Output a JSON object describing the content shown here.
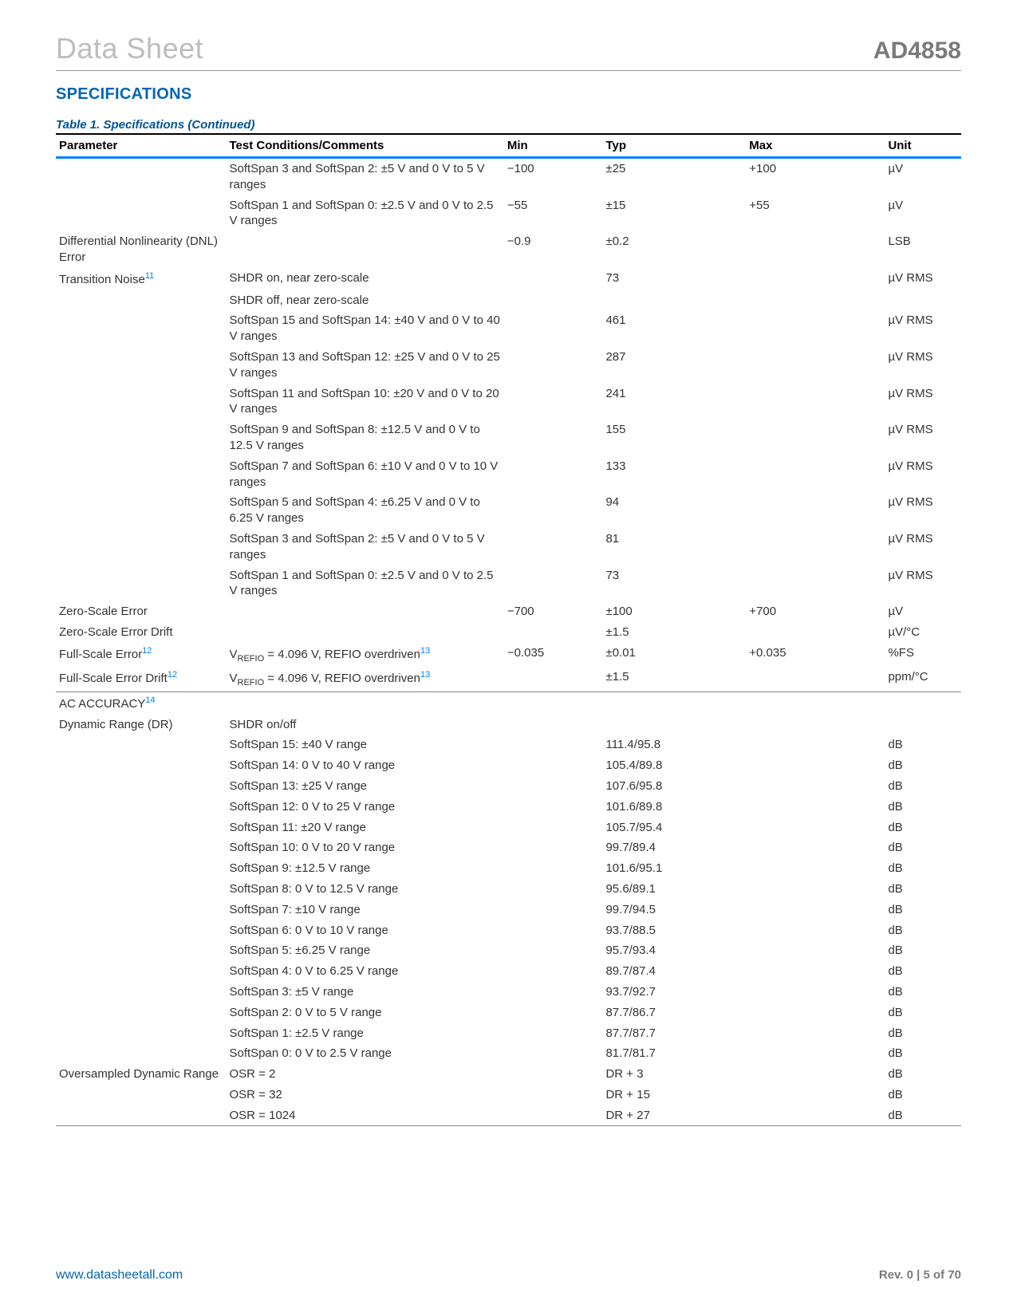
{
  "header": {
    "doc_type": "Data Sheet",
    "part_number": "AD4858"
  },
  "section_title": "SPECIFICATIONS",
  "table_caption": "Table 1. Specifications (Continued)",
  "columns": {
    "parameter": "Parameter",
    "conditions": "Test Conditions/Comments",
    "min": "Min",
    "typ": "Typ",
    "max": "Max",
    "unit": "Unit"
  },
  "rows": [
    {
      "param": "",
      "cond": "SoftSpan 3 and SoftSpan 2: ±5 V and 0 V to 5 V ranges",
      "min": "−100",
      "typ": "±25",
      "max": "+100",
      "unit": "µV"
    },
    {
      "param": "",
      "cond": "SoftSpan 1 and SoftSpan 0: ±2.5 V and 0 V to 2.5 V ranges",
      "min": "−55",
      "typ": "±15",
      "max": "+55",
      "unit": "µV"
    },
    {
      "param": "Differential Nonlinearity (DNL) Error",
      "cond": "",
      "min": "−0.9",
      "typ": "±0.2",
      "max": "",
      "unit": "LSB"
    },
    {
      "param_html": "Transition Noise<span class=\"sup\">11</span>",
      "cond": "SHDR on, near zero-scale",
      "min": "",
      "typ": "73",
      "max": "",
      "unit": "µV RMS"
    },
    {
      "param": "",
      "cond": "SHDR off, near zero-scale",
      "min": "",
      "typ": "",
      "max": "",
      "unit": ""
    },
    {
      "param": "",
      "cond": "SoftSpan 15 and SoftSpan 14: ±40 V and 0 V to 40 V ranges",
      "min": "",
      "typ": "461",
      "max": "",
      "unit": "µV RMS"
    },
    {
      "param": "",
      "cond": "SoftSpan 13 and SoftSpan 12: ±25 V and 0 V to 25 V ranges",
      "min": "",
      "typ": "287",
      "max": "",
      "unit": "µV RMS"
    },
    {
      "param": "",
      "cond": "SoftSpan 11 and SoftSpan 10: ±20 V and 0 V to 20 V ranges",
      "min": "",
      "typ": "241",
      "max": "",
      "unit": "µV RMS"
    },
    {
      "param": "",
      "cond": "SoftSpan 9 and SoftSpan 8: ±12.5 V and 0 V to 12.5 V ranges",
      "min": "",
      "typ": "155",
      "max": "",
      "unit": "µV RMS"
    },
    {
      "param": "",
      "cond": "SoftSpan 7 and SoftSpan 6: ±10 V and 0 V to 10 V ranges",
      "min": "",
      "typ": "133",
      "max": "",
      "unit": "µV RMS"
    },
    {
      "param": "",
      "cond": "SoftSpan 5 and SoftSpan 4: ±6.25 V and 0 V to 6.25 V ranges",
      "min": "",
      "typ": "94",
      "max": "",
      "unit": "µV RMS"
    },
    {
      "param": "",
      "cond": "SoftSpan 3 and SoftSpan 2: ±5 V and 0 V to 5 V ranges",
      "min": "",
      "typ": "81",
      "max": "",
      "unit": "µV RMS"
    },
    {
      "param": "",
      "cond": "SoftSpan 1 and SoftSpan 0: ±2.5 V and 0 V to 2.5 V ranges",
      "min": "",
      "typ": "73",
      "max": "",
      "unit": "µV RMS"
    },
    {
      "param": "Zero-Scale Error",
      "cond": "",
      "min": "−700",
      "typ": "±100",
      "max": "+700",
      "unit": "µV"
    },
    {
      "param": "Zero-Scale Error Drift",
      "cond": "",
      "min": "",
      "typ": "±1.5",
      "max": "",
      "unit": "µV/°C"
    },
    {
      "param_html": "Full-Scale Error<span class=\"sup\">12</span>",
      "cond_html": "V<span class=\"subscript\">REFIO</span> = 4.096 V, REFIO overdriven<span class=\"sup\">13</span>",
      "min": "−0.035",
      "typ": "±0.01",
      "max": "+0.035",
      "unit": "%FS"
    },
    {
      "param_html": "Full-Scale Error Drift<span class=\"sup\">12</span>",
      "cond_html": "V<span class=\"subscript\">REFIO</span> = 4.096 V, REFIO overdriven<span class=\"sup\">13</span>",
      "min": "",
      "typ": "±1.5",
      "max": "",
      "unit": "ppm/°C",
      "section_end": true
    },
    {
      "param_html": "AC ACCURACY<span class=\"sup\">14</span>",
      "level0": true,
      "cond": "",
      "min": "",
      "typ": "",
      "max": "",
      "unit": ""
    },
    {
      "param": "Dynamic Range (DR)",
      "cond": "SHDR on/off",
      "min": "",
      "typ": "",
      "max": "",
      "unit": ""
    },
    {
      "param": "",
      "cond": "SoftSpan 15: ±40 V range",
      "min": "",
      "typ": "111.4/95.8",
      "max": "",
      "unit": "dB"
    },
    {
      "param": "",
      "cond": "SoftSpan 14: 0 V to 40 V range",
      "min": "",
      "typ": "105.4/89.8",
      "max": "",
      "unit": "dB"
    },
    {
      "param": "",
      "cond": "SoftSpan 13: ±25 V range",
      "min": "",
      "typ": "107.6/95.8",
      "max": "",
      "unit": "dB"
    },
    {
      "param": "",
      "cond": "SoftSpan 12: 0 V to 25 V range",
      "min": "",
      "typ": "101.6/89.8",
      "max": "",
      "unit": "dB"
    },
    {
      "param": "",
      "cond": "SoftSpan 11: ±20 V range",
      "min": "",
      "typ": "105.7/95.4",
      "max": "",
      "unit": "dB"
    },
    {
      "param": "",
      "cond": "SoftSpan 10: 0 V to 20 V range",
      "min": "",
      "typ": "99.7/89.4",
      "max": "",
      "unit": "dB"
    },
    {
      "param": "",
      "cond": "SoftSpan 9: ±12.5 V range",
      "min": "",
      "typ": "101.6/95.1",
      "max": "",
      "unit": "dB"
    },
    {
      "param": "",
      "cond": "SoftSpan 8: 0 V to 12.5 V range",
      "min": "",
      "typ": "95.6/89.1",
      "max": "",
      "unit": "dB"
    },
    {
      "param": "",
      "cond": "SoftSpan 7: ±10 V range",
      "min": "",
      "typ": "99.7/94.5",
      "max": "",
      "unit": "dB"
    },
    {
      "param": "",
      "cond": "SoftSpan 6: 0 V to 10 V range",
      "min": "",
      "typ": "93.7/88.5",
      "max": "",
      "unit": "dB"
    },
    {
      "param": "",
      "cond": "SoftSpan 5: ±6.25 V range",
      "min": "",
      "typ": "95.7/93.4",
      "max": "",
      "unit": "dB"
    },
    {
      "param": "",
      "cond": "SoftSpan 4: 0 V to 6.25 V range",
      "min": "",
      "typ": "89.7/87.4",
      "max": "",
      "unit": "dB"
    },
    {
      "param": "",
      "cond": "SoftSpan 3: ±5 V range",
      "min": "",
      "typ": "93.7/92.7",
      "max": "",
      "unit": "dB"
    },
    {
      "param": "",
      "cond": "SoftSpan 2: 0 V to 5 V range",
      "min": "",
      "typ": "87.7/86.7",
      "max": "",
      "unit": "dB"
    },
    {
      "param": "",
      "cond": "SoftSpan 1: ±2.5 V range",
      "min": "",
      "typ": "87.7/87.7",
      "max": "",
      "unit": "dB"
    },
    {
      "param": "",
      "cond": "SoftSpan 0: 0 V to 2.5 V range",
      "min": "",
      "typ": "81.7/81.7",
      "max": "",
      "unit": "dB"
    },
    {
      "param": "Oversampled Dynamic Range",
      "cond": "OSR = 2",
      "min": "",
      "typ": "DR + 3",
      "max": "",
      "unit": "dB"
    },
    {
      "param": "",
      "cond": "OSR = 32",
      "min": "",
      "typ": "DR + 15",
      "max": "",
      "unit": "dB"
    },
    {
      "param": "",
      "cond": "OSR = 1024",
      "min": "",
      "typ": "DR + 27",
      "max": "",
      "unit": "dB",
      "section_end": true
    }
  ],
  "footer": {
    "url": "www.datasheetall.com",
    "rev": "Rev. 0 | 5 of 70"
  }
}
